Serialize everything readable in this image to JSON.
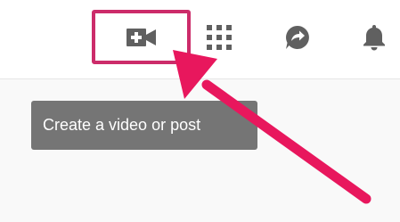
{
  "header": {
    "buttons": [
      {
        "icon": "video-plus-icon"
      },
      {
        "icon": "apps-grid-icon"
      },
      {
        "icon": "share-messages-icon"
      },
      {
        "icon": "bell-icon"
      }
    ]
  },
  "tooltip": {
    "text": "Create a video or post"
  },
  "colors": {
    "highlight": "#cc2c6a",
    "arrow": "#e8175d",
    "icon": "#606060",
    "tooltip_bg": "#757575"
  }
}
